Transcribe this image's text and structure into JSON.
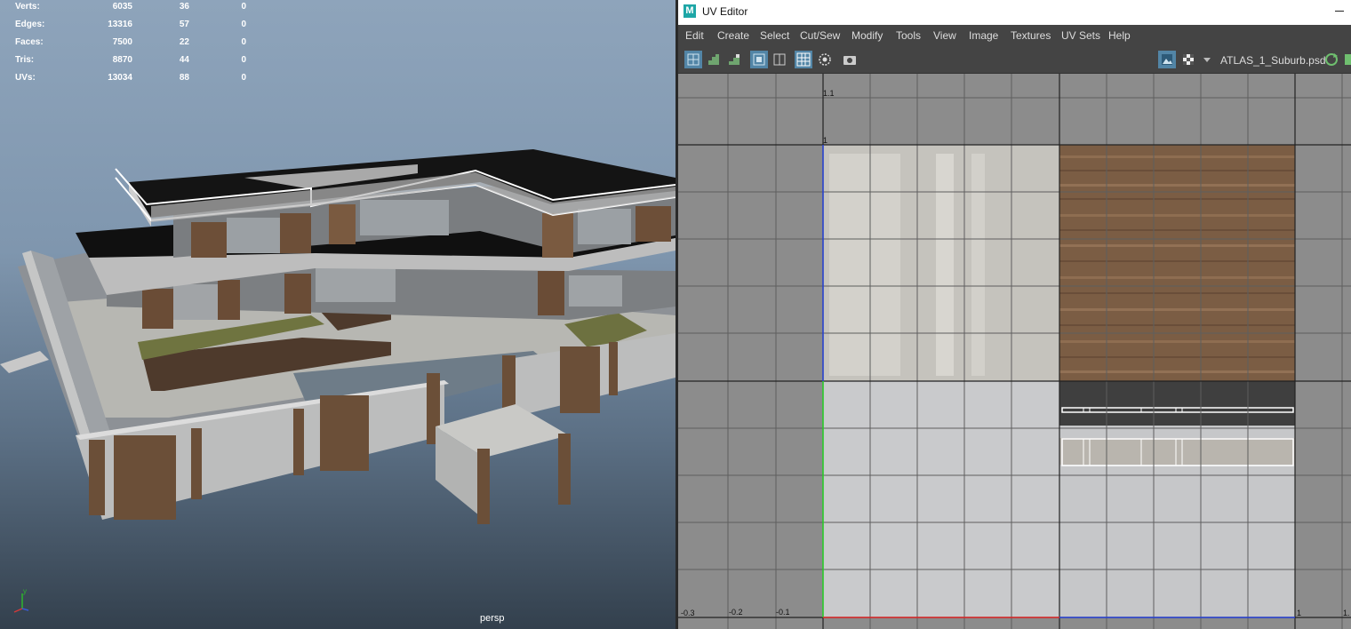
{
  "viewport": {
    "hud": [
      {
        "label": "Verts:",
        "c1": "6035",
        "c2": "36",
        "c3": "0"
      },
      {
        "label": "Edges:",
        "c1": "13316",
        "c2": "57",
        "c3": "0"
      },
      {
        "label": "Faces:",
        "c1": "7500",
        "c2": "22",
        "c3": "0"
      },
      {
        "label": "Tris:",
        "c1": "8870",
        "c2": "44",
        "c3": "0"
      },
      {
        "label": "UVs:",
        "c1": "13034",
        "c2": "88",
        "c3": "0"
      }
    ],
    "camera_label": "persp",
    "gizmo_y": "y"
  },
  "uv_editor": {
    "logo": "M",
    "title": "UV Editor",
    "menu": [
      "Edit",
      "Create",
      "Select",
      "Cut/Sew",
      "Modify",
      "Tools",
      "View",
      "Image",
      "Textures",
      "UV Sets",
      "Help"
    ],
    "texture_name": "ATLAS_1_Suburb.psd",
    "axis_labels": {
      "v_1_1": "1.1",
      "v_1": "1",
      "u_m03": "-0.3",
      "u_m02": "-0.2",
      "u_m01": "-0.1",
      "u_1": "1",
      "u_1_1": "1."
    },
    "toolbar_icons": [
      "uv-grid-icon",
      "stairs-icon",
      "stairs-alt-icon",
      "uv-shell-icon",
      "uv-border-icon",
      "grid-toggle-icon",
      "circle-select-icon",
      "snapshot-icon",
      "image-display-icon",
      "checker-icon",
      "dropdown-arrow-icon",
      "refresh-icon"
    ]
  },
  "colors": {
    "accent": "#5285a6",
    "hud_text": "#ffffff",
    "menu_text": "#dddddd"
  }
}
